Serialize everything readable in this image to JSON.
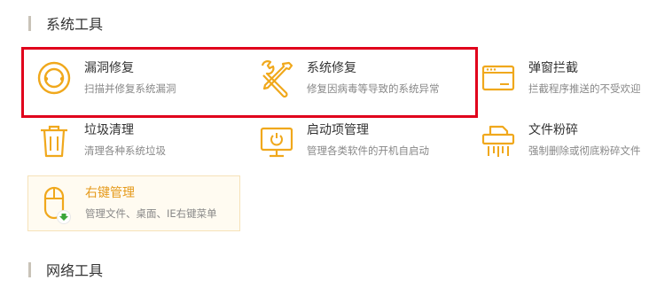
{
  "sections": {
    "system_title": "系统工具",
    "network_title": "网络工具"
  },
  "tools": {
    "leak": {
      "name": "漏洞修复",
      "desc": "扫描并修复系统漏洞"
    },
    "repair": {
      "name": "系统修复",
      "desc": "修复因病毒等导致的系统异常"
    },
    "popup": {
      "name": "弹窗拦截",
      "desc": "拦截程序推送的不受欢迎"
    },
    "junk": {
      "name": "垃圾清理",
      "desc": "清理各种系统垃圾"
    },
    "startup": {
      "name": "启动项管理",
      "desc": "管理各类软件的开机自启动"
    },
    "shred": {
      "name": "文件粉碎",
      "desc": "强制删除或彻底粉碎文件"
    },
    "rclick": {
      "name": "右键管理",
      "desc": "管理文件、桌面、IE右键菜单"
    }
  },
  "colors": {
    "accent": "#f0a81c",
    "highlight": "#e0001b",
    "download_badge": "#3aa63a"
  },
  "icons": {
    "leak": "shield-circle-icon",
    "repair": "wrench-screwdriver-icon",
    "popup": "popup-window-icon",
    "junk": "trash-can-icon",
    "startup": "monitor-power-icon",
    "shred": "shredder-icon",
    "rclick": "mouse-icon"
  }
}
